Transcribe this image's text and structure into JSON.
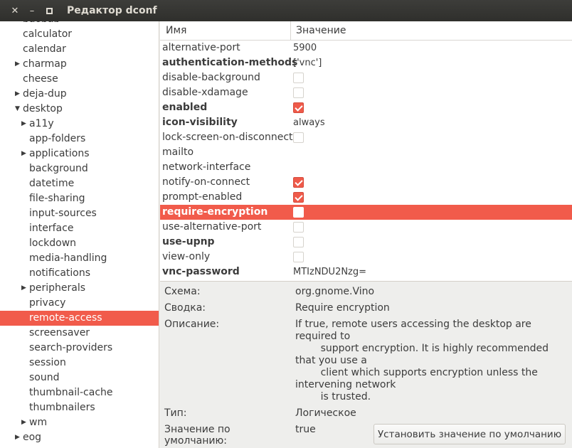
{
  "window": {
    "title": "Редактор dconf",
    "close_glyph": "✕",
    "minimize_glyph": "–"
  },
  "sidebar": {
    "items": [
      {
        "label": "baobab",
        "depth": 0,
        "arrow": ""
      },
      {
        "label": "calculator",
        "depth": 0,
        "arrow": ""
      },
      {
        "label": "calendar",
        "depth": 0,
        "arrow": ""
      },
      {
        "label": "charmap",
        "depth": 0,
        "arrow": "▶"
      },
      {
        "label": "cheese",
        "depth": 0,
        "arrow": ""
      },
      {
        "label": "deja-dup",
        "depth": 0,
        "arrow": "▶"
      },
      {
        "label": "desktop",
        "depth": 0,
        "arrow": "▼"
      },
      {
        "label": "a11y",
        "depth": 1,
        "arrow": "▶"
      },
      {
        "label": "app-folders",
        "depth": 1,
        "arrow": ""
      },
      {
        "label": "applications",
        "depth": 1,
        "arrow": "▶"
      },
      {
        "label": "background",
        "depth": 1,
        "arrow": ""
      },
      {
        "label": "datetime",
        "depth": 1,
        "arrow": ""
      },
      {
        "label": "file-sharing",
        "depth": 1,
        "arrow": ""
      },
      {
        "label": "input-sources",
        "depth": 1,
        "arrow": ""
      },
      {
        "label": "interface",
        "depth": 1,
        "arrow": ""
      },
      {
        "label": "lockdown",
        "depth": 1,
        "arrow": ""
      },
      {
        "label": "media-handling",
        "depth": 1,
        "arrow": ""
      },
      {
        "label": "notifications",
        "depth": 1,
        "arrow": ""
      },
      {
        "label": "peripherals",
        "depth": 1,
        "arrow": "▶"
      },
      {
        "label": "privacy",
        "depth": 1,
        "arrow": ""
      },
      {
        "label": "remote-access",
        "depth": 1,
        "arrow": "",
        "selected": true
      },
      {
        "label": "screensaver",
        "depth": 1,
        "arrow": ""
      },
      {
        "label": "search-providers",
        "depth": 1,
        "arrow": ""
      },
      {
        "label": "session",
        "depth": 1,
        "arrow": ""
      },
      {
        "label": "sound",
        "depth": 1,
        "arrow": ""
      },
      {
        "label": "thumbnail-cache",
        "depth": 1,
        "arrow": ""
      },
      {
        "label": "thumbnailers",
        "depth": 1,
        "arrow": ""
      },
      {
        "label": "wm",
        "depth": 1,
        "arrow": "▶"
      },
      {
        "label": "eog",
        "depth": 0,
        "arrow": "▶"
      }
    ]
  },
  "keys": {
    "col_name": "Имя",
    "col_value": "Значение",
    "rows": [
      {
        "name": "alternative-port",
        "bold": false,
        "type": "text",
        "value": "5900"
      },
      {
        "name": "authentication-methods",
        "bold": true,
        "type": "text",
        "value": "['vnc']"
      },
      {
        "name": "disable-background",
        "bold": false,
        "type": "bool",
        "checked": false
      },
      {
        "name": "disable-xdamage",
        "bold": false,
        "type": "bool",
        "checked": false
      },
      {
        "name": "enabled",
        "bold": true,
        "type": "bool",
        "checked": true
      },
      {
        "name": "icon-visibility",
        "bold": true,
        "type": "text",
        "value": "always"
      },
      {
        "name": "lock-screen-on-disconnect",
        "bold": false,
        "type": "bool",
        "checked": false
      },
      {
        "name": "mailto",
        "bold": false,
        "type": "text",
        "value": ""
      },
      {
        "name": "network-interface",
        "bold": false,
        "type": "text",
        "value": ""
      },
      {
        "name": "notify-on-connect",
        "bold": false,
        "type": "bool",
        "checked": true
      },
      {
        "name": "prompt-enabled",
        "bold": false,
        "type": "bool",
        "checked": true
      },
      {
        "name": "require-encryption",
        "bold": true,
        "type": "bool",
        "checked": false,
        "selected": true
      },
      {
        "name": "use-alternative-port",
        "bold": false,
        "type": "bool",
        "checked": false
      },
      {
        "name": "use-upnp",
        "bold": true,
        "type": "bool",
        "checked": false
      },
      {
        "name": "view-only",
        "bold": false,
        "type": "bool",
        "checked": false
      },
      {
        "name": "vnc-password",
        "bold": true,
        "type": "text",
        "value": "MTIzNDU2Nzg="
      }
    ]
  },
  "details": {
    "schema_label": "Схема:",
    "schema_value": "org.gnome.Vino",
    "summary_label": "Сводка:",
    "summary_value": "Require encryption",
    "description_label": "Описание:",
    "description_value": "If true, remote users accessing the desktop are required to\n        support encryption. It is highly recommended that you use a\n        client which supports encryption unless the intervening network\n        is trusted.",
    "type_label": "Тип:",
    "type_value": "Логическое",
    "default_label": "Значение по умолчанию:",
    "default_value": "true",
    "reset_button": "Установить значение по умолчанию"
  },
  "colors": {
    "accent": "#f15b4b",
    "titlebar": "#3c3b37"
  }
}
